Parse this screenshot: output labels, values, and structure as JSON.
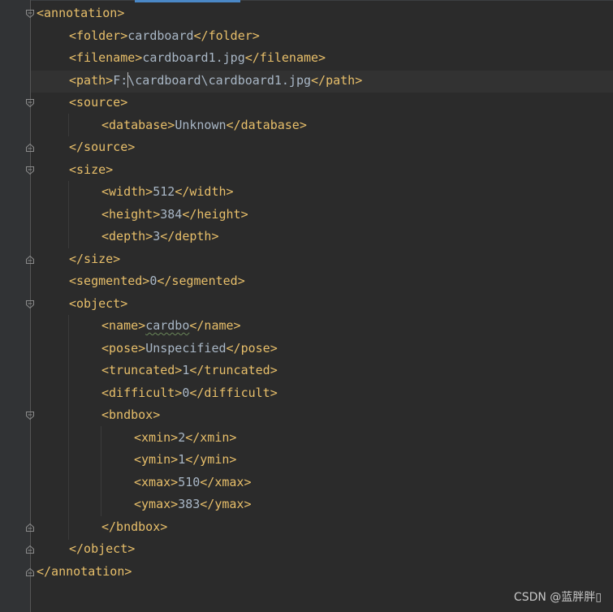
{
  "lines": [
    {
      "open": "<annotation>"
    },
    {
      "open": "<folder>",
      "value": "cardboard",
      "close": "</folder>"
    },
    {
      "open": "<filename>",
      "value": "cardboard1.jpg",
      "close": "</filename>"
    },
    {
      "open": "<path>",
      "value_before_caret": "F:",
      "value_after_caret": "\\cardboard\\cardboard1.jpg",
      "close": "</path>"
    },
    {
      "open": "<source>"
    },
    {
      "open": "<database>",
      "value": "Unknown",
      "close": "</database>"
    },
    {
      "close": "</source>"
    },
    {
      "open": "<size>"
    },
    {
      "open": "<width>",
      "value": "512",
      "close": "</width>"
    },
    {
      "open": "<height>",
      "value": "384",
      "close": "</height>"
    },
    {
      "open": "<depth>",
      "value": "3",
      "close": "</depth>"
    },
    {
      "close": "</size>"
    },
    {
      "open": "<segmented>",
      "value": "0",
      "close": "</segmented>"
    },
    {
      "open": "<object>"
    },
    {
      "open": "<name>",
      "value": "cardbo",
      "close": "</name>"
    },
    {
      "open": "<pose>",
      "value": "Unspecified",
      "close": "</pose>"
    },
    {
      "open": "<truncated>",
      "value": "1",
      "close": "</truncated>"
    },
    {
      "open": "<difficult>",
      "value": "0",
      "close": "</difficult>"
    },
    {
      "open": "<bndbox>"
    },
    {
      "open": "<xmin>",
      "value": "2",
      "close": "</xmin>"
    },
    {
      "open": "<ymin>",
      "value": "1",
      "close": "</ymin>"
    },
    {
      "open": "<xmax>",
      "value": "510",
      "close": "</xmax>"
    },
    {
      "open": "<ymax>",
      "value": "383",
      "close": "</ymax>"
    },
    {
      "close": "</bndbox>"
    },
    {
      "close": "</object>"
    },
    {
      "close": "</annotation>"
    }
  ],
  "watermark": "CSDN @蓝胖胖▯",
  "colors": {
    "background": "#2b2b2b",
    "gutter": "#313335",
    "tag": "#e8bf6a",
    "text": "#a9b7c6",
    "tab_indicator": "#4a88c7"
  },
  "icons": {
    "fold_open": "fold-open-icon",
    "fold_close": "fold-close-icon"
  }
}
